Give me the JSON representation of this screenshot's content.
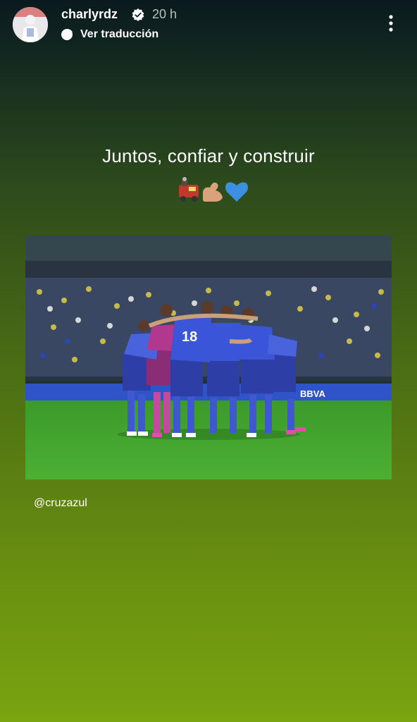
{
  "story": {
    "username": "charlyrdz",
    "time": "20 h",
    "translate_label": "Ver traducción",
    "caption": "Juntos, confiar y construir",
    "emojis": [
      "train-emoji",
      "flexed-biceps-emoji",
      "blue-heart-emoji"
    ],
    "mention": "@cruzazul",
    "photo": {
      "description_icon": "team-huddle-photo",
      "jersey_numbers": [
        "18"
      ],
      "sponsor_text": "BBVA"
    }
  },
  "colors": {
    "background_top": "#0a1a1e",
    "background_bottom": "#7aa410",
    "jersey_blue": "#3a55d8",
    "goalkeeper_pink": "#b0388e",
    "pitch_green": "#43a52a"
  }
}
